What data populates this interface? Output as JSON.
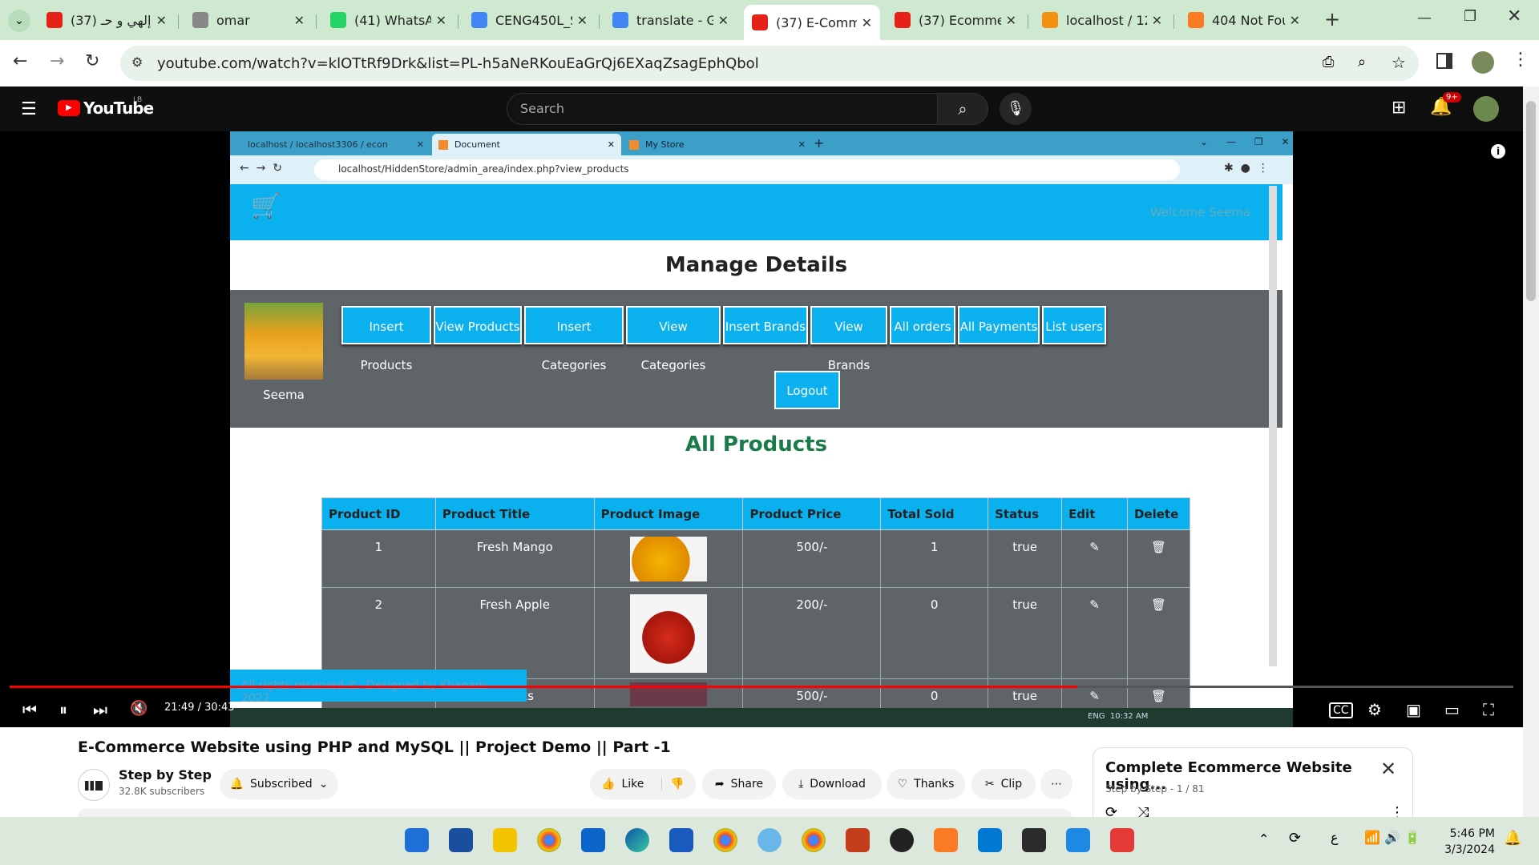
{
  "browser": {
    "tabs": [
      {
        "label": "(37) إلهي و حـ",
        "icon": "youtube-icon",
        "color": "#e62117"
      },
      {
        "label": "omar",
        "icon": "globe-icon",
        "color": "#888888"
      },
      {
        "label": "(41) WhatsAp",
        "icon": "whatsapp-icon",
        "color": "#25d366"
      },
      {
        "label": "CENG450L_S",
        "icon": "contacts-icon",
        "color": "#4285f4"
      },
      {
        "label": "translate - Go",
        "icon": "google-icon",
        "color": "#4285f4"
      },
      {
        "label": "(37) E-Comm",
        "icon": "youtube-icon",
        "color": "#e62117"
      },
      {
        "label": "(37) Ecomme",
        "icon": "youtube-icon",
        "color": "#e62117"
      },
      {
        "label": "localhost / 12",
        "icon": "phpmyadmin-icon",
        "color": "#f29111"
      },
      {
        "label": "404 Not Fou",
        "icon": "xampp-icon",
        "color": "#fb7a24"
      }
    ],
    "url": "youtube.com/watch?v=klOTtRf9Drk&list=PL-h5aNeRKouEaGrQj6EXaqZsagEphQbol"
  },
  "youtube": {
    "logo": "YouTube",
    "region": "LB",
    "search_placeholder": "Search",
    "notif_count": "9+"
  },
  "inner": {
    "tabs": [
      "localhost / localhost3306 / econ",
      "Document",
      "My Store"
    ],
    "url": "localhost/HiddenStore/admin_area/index.php?view_products",
    "welcome": "Welcome Seema",
    "manage_title": "Manage Details",
    "admin_name": "Seema",
    "nav": [
      "Insert Products",
      "View Products",
      "Insert Categories",
      "View Categories",
      "Insert Brands",
      "View Brands",
      "All orders",
      "All Payments",
      "List users"
    ],
    "logout": "Logout",
    "all_products": "All Products",
    "columns": [
      "Product ID",
      "Product Title",
      "Product Image",
      "Product Price",
      "Total Sold",
      "Status",
      "Edit",
      "Delete"
    ],
    "rows": [
      {
        "id": "1",
        "title": "Fresh Mango",
        "price": "500/-",
        "sold": "1",
        "status": "true"
      },
      {
        "id": "2",
        "title": "Fresh Apple",
        "price": "200/-",
        "sold": "0",
        "status": "true"
      },
      {
        "id": "",
        "title": "Frocks",
        "price": "500/-",
        "sold": "0",
        "status": "true"
      }
    ],
    "footer": "All rights reserved ©- Designed by Khanam-2022",
    "clock": "10:32 AM",
    "lang": "ENG"
  },
  "player": {
    "time": "21:49 / 30:43",
    "progress": 0.71
  },
  "video": {
    "title": "E-Commerce Website using PHP and MySQL || Project Demo || Part -1",
    "channel": "Step by Step",
    "subs": "32.8K subscribers",
    "subscribed": "Subscribed",
    "like": "Like",
    "share": "Share",
    "download": "Download",
    "thanks": "Thanks",
    "clip": "Clip"
  },
  "playlist": {
    "title": "Complete Ecommerce Website  using...",
    "sub": "Step by Step - 1 / 81"
  },
  "taskbar": {
    "time": "5:46 PM",
    "date": "3/3/2024",
    "input": "ع"
  }
}
